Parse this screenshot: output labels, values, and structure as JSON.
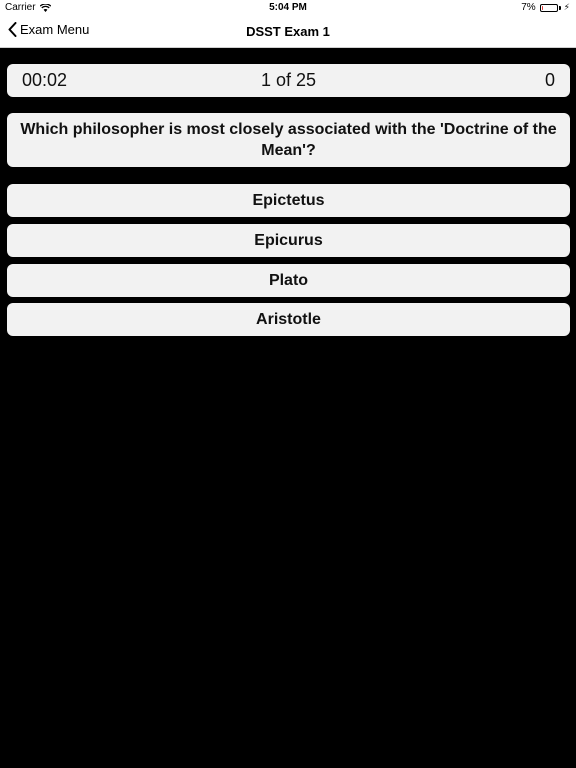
{
  "status_bar": {
    "carrier": "Carrier",
    "time": "5:04 PM",
    "battery_percent": "7%",
    "battery_level": 0.07,
    "battery_color": "#e03a3a"
  },
  "nav": {
    "back_label": "Exam Menu",
    "title": "DSST Exam 1"
  },
  "quiz": {
    "timer": "00:02",
    "progress": "1 of 25",
    "score": "0",
    "question": "Which philosopher is most closely associated with the 'Doctrine of the Mean'?",
    "answers": [
      "Epictetus",
      "Epicurus",
      "Plato",
      "Aristotle"
    ]
  },
  "icons": {
    "wifi": "wifi-icon",
    "battery": "battery-icon",
    "charging": "charging-bolt-icon",
    "back": "chevron-left-icon"
  }
}
